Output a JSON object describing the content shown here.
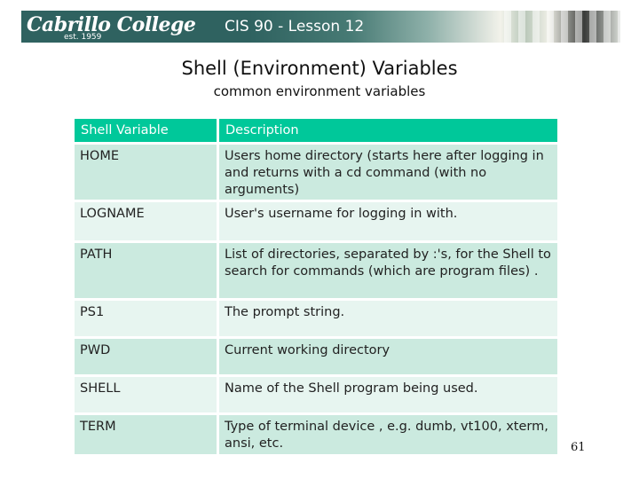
{
  "banner": {
    "logo_name": "Cabrillo College",
    "logo_est": "est. 1959",
    "title": "CIS 90 - Lesson 12"
  },
  "slide": {
    "title": "Shell (Environment) Variables",
    "subtitle": "common environment variables",
    "page_number": "61"
  },
  "table": {
    "headers": [
      "Shell Variable",
      "Description"
    ],
    "rows": [
      {
        "variable": "HOME",
        "description": "Users home directory (starts here after logging in and returns with a cd  command (with no arguments)",
        "rows_height": 3
      },
      {
        "variable": "LOGNAME",
        "description": "User's username for logging in with.",
        "rows_height": 2
      },
      {
        "variable": "PATH",
        "description": "List of directories, separated  by :'s, for the Shell to search for commands (which are program files) .",
        "rows_height": 3
      },
      {
        "variable": "PS1",
        "description": "The prompt string.",
        "rows_height": 2
      },
      {
        "variable": "PWD",
        "description": "Current working directory",
        "rows_height": 2
      },
      {
        "variable": "SHELL",
        "description": "Name of the Shell program  being used.",
        "rows_height": 2
      },
      {
        "variable": "TERM",
        "description": "Type of terminal device , e.g. dumb, vt100, xterm, ansi, etc.",
        "rows_height": 2
      }
    ]
  },
  "colors": {
    "header_bg": "#00c89a",
    "row_dark": "#cbeadf",
    "row_light": "#e7f5f0",
    "banner_bg": "#2f6260"
  }
}
